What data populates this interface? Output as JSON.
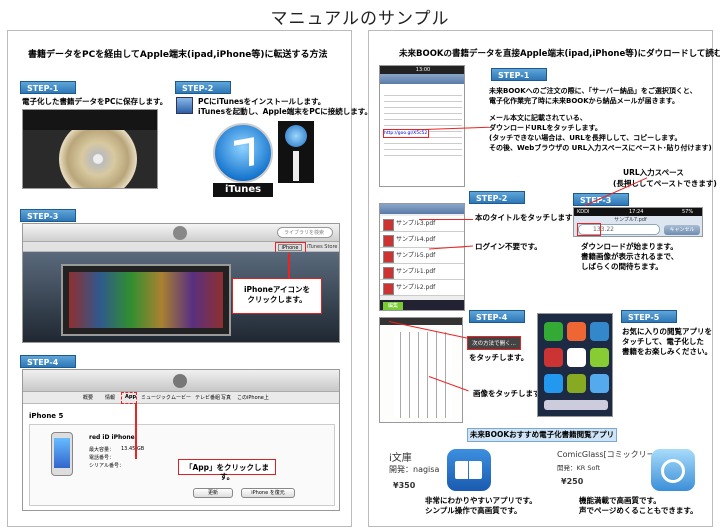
{
  "page_title": "マニュアルのサンプル",
  "left": {
    "heading": "書籍データをPCを経由してApple端末(ipad,iPhone等)に転送する方法",
    "step1": {
      "label": "STEP-1",
      "text": "電子化した書籍データをPCに保存します。"
    },
    "step2": {
      "label": "STEP-2",
      "line1": "PCにiTunesをインストールします。",
      "line2": "iTunesを起動し、Apple端末をPCに接続します。",
      "itunes_label": "iTunes"
    },
    "step3": {
      "label": "STEP-3",
      "callout_line1": "iPhoneアイコンを",
      "callout_line2": "クリックします。",
      "search_placeholder": "ライブラリを検索",
      "iphone_button": "iPhone",
      "store_link": "iTunes Store"
    },
    "step4": {
      "label": "STEP-4",
      "tabs": [
        "概要",
        "情報",
        "App",
        "ミュージック",
        "ムービー",
        "テレビ番組",
        "写真",
        "このiPhone上"
      ],
      "device_heading": "iPhone 5",
      "device_name": "red iD iPhone",
      "device_capacity_label": "最大容量：",
      "device_capacity_value": "13.45 GB",
      "device_phone_label": "電話番号：",
      "device_serial_label": "シリアル番号：",
      "callout": "「App」をクリックします。",
      "update_button": "更新",
      "restore_button": "iPhone を復元"
    }
  },
  "right": {
    "heading": "未来BOOKの書籍データを直接Apple端末(ipad,iPhone等)にダウロードして読む方法",
    "step1": {
      "label": "STEP-1",
      "line1": "未来BOOKへのご注文の際に、「サーバー納品」をご選択頂くと、",
      "line2": "電子化作業完了時に未来BOOKから納品メールが届きます。",
      "line3": "メール本文に記載されている、",
      "line4": "ダウンロードURLをタッチします。",
      "line5": "(タッチできない場合は、URLを長押しして、コピーします。",
      "line6": "その後、Webブラウザの URL入力スペースにペースト･貼り付けます)",
      "phone_time": "13:00",
      "phone_url": "http://goo.gl/X5c52"
    },
    "step2": {
      "label": "STEP-2",
      "files": [
        "サンプル3.pdf",
        "サンプル4.pdf",
        "サンプル5.pdf",
        "サンプル1.pdf",
        "サンプル2.pdf"
      ],
      "file_size": "1.5 MB",
      "text1": "本のタイトルをタッチします",
      "text2": "ログイン不要です。",
      "edit_button": "編集"
    },
    "step3": {
      "label": "STEP-3",
      "url_caption1": "URL入力スペース",
      "url_caption2": "(長押ししてペーストできます)",
      "carrier": "KDDI",
      "time": "17:24",
      "battery": "57%",
      "filename": "サンプル7.pdf",
      "url_value": "133.22",
      "cancel": "キャンセル",
      "line1": "ダウンロードが始まります。",
      "line2": "書籍画像が表示されるまで、",
      "line3": "しばらくの間待ちます。"
    },
    "step4": {
      "label": "STEP-4",
      "button_label": "次の方法で開く...",
      "text1": "をタッチします。",
      "text2": "画像をタッチします。"
    },
    "step5": {
      "label": "STEP-5",
      "line1": "お気に入りの閲覧アプリを",
      "line2": "タッチして、電子化した",
      "line3": "書籍をお楽しみください。"
    },
    "recommend": {
      "banner": "未来BOOKおすすめ電子化書籍閲覧アプリ",
      "app1": {
        "name": "i文庫",
        "dev": "開発：nagisa",
        "price": "¥350",
        "desc1": "非常にわかりやすいアプリです。",
        "desc2": "シンプル操作で高画質です。"
      },
      "app2": {
        "name": "ComicGlass[コミックリーダ]",
        "dev": "開発：KR Soft",
        "price": "¥250",
        "desc1": "機能満載で高画質です。",
        "desc2": "声でページめくることもできます。"
      }
    }
  },
  "colors": {
    "step_blue": "#2e78b8",
    "callout_red": "#e22",
    "banner_blue": "#cfe4f6"
  }
}
